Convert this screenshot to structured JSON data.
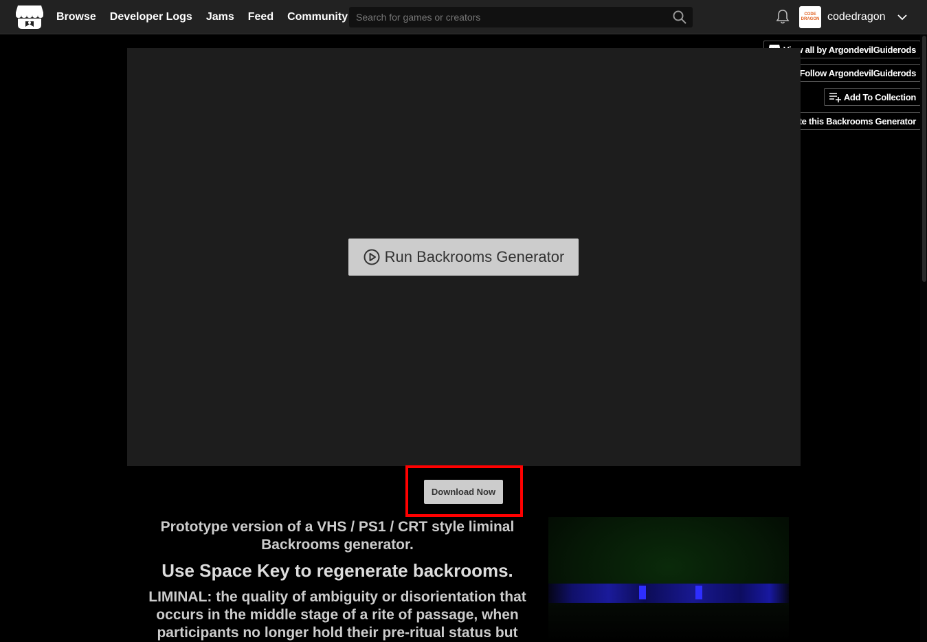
{
  "header": {
    "nav": [
      "Browse",
      "Developer Logs",
      "Jams",
      "Feed",
      "Community"
    ],
    "search_placeholder": "Search for games or creators",
    "username": "codedragon",
    "avatar_text": "CODE DRAGON"
  },
  "side_actions": [
    {
      "label": "View all by ArgondevilGuiderods",
      "icon": "store-icon"
    },
    {
      "label": "Follow ArgondevilGuiderods",
      "icon": "user-plus-icon"
    },
    {
      "label": "Add To Collection",
      "icon": "add-list-icon"
    },
    {
      "label": "Rate this Backrooms Generator",
      "icon": "star-icon"
    }
  ],
  "game": {
    "run_label": "Run Backrooms Generator"
  },
  "download": {
    "label": "Download Now",
    "highlight_color": "#ff0000"
  },
  "description": {
    "intro": "Prototype version of a VHS / PS1 / CRT style liminal Backrooms generator.",
    "instruction": "Use Space Key to regenerate backrooms.",
    "definition": "LIMINAL: the quality of ambiguity or disorientation that occurs in the middle stage of a rite of passage, when participants no longer hold their pre-ritual status but"
  },
  "colors": {
    "header_bg": "#222222",
    "page_bg": "#000000",
    "frame_bg": "#1d1d1d",
    "button_bg": "#cccccc"
  }
}
